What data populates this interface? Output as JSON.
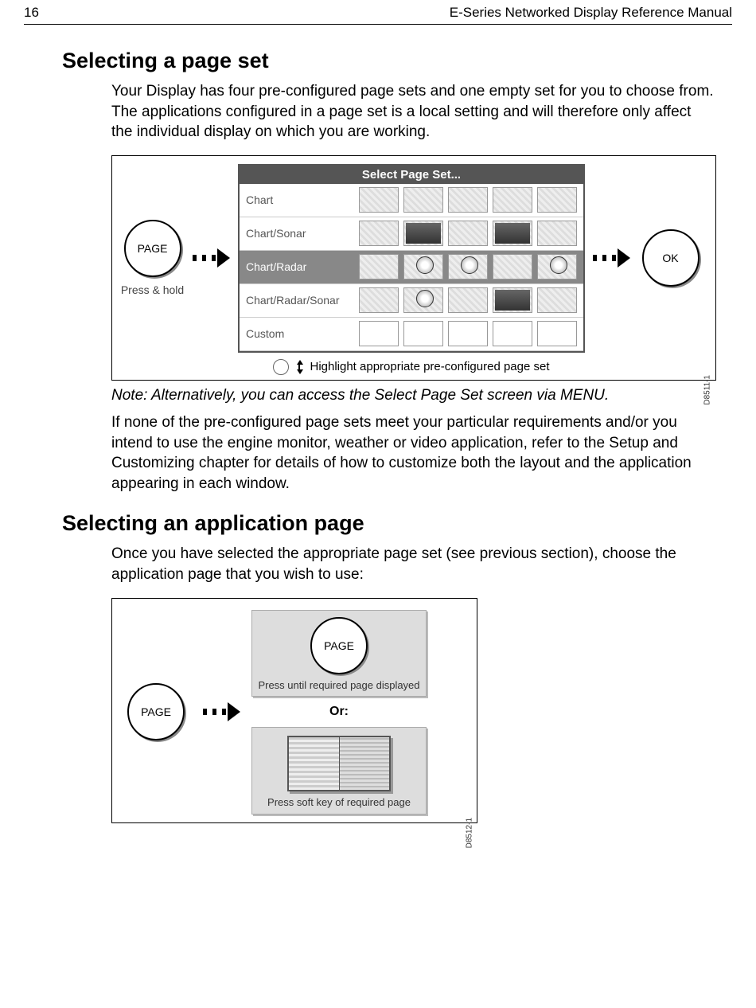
{
  "header": {
    "page_num": "16",
    "manual_title": "E-Series Networked Display Reference Manual"
  },
  "section1": {
    "heading": "Selecting a page set",
    "para1": "Your Display has four pre-configured page sets and one empty set for you to choose from. The applications configured in a page set is a local setting and will therefore only affect the individual display on which you are working.",
    "button_left": "PAGE",
    "button_left_caption": "Press & hold",
    "button_right": "OK",
    "dialog_title": "Select Page Set...",
    "rows": {
      "r0": "Chart",
      "r1": "Chart/Sonar",
      "r2": "Chart/Radar",
      "r3": "Chart/Radar/Sonar",
      "r4": "Custom"
    },
    "fig_caption": "Highlight appropriate pre-configured page set",
    "fig_id": "D8511-1",
    "note": "Note: Alternatively, you can access the Select Page Set screen via MENU.",
    "para2": "If none of the pre-configured page sets meet your particular requirements and/or you intend to use the engine monitor, weather or video application, refer to the Setup and Customizing chapter for details of how to customize both the layout and the application appearing in each window."
  },
  "section2": {
    "heading": "Selecting an application page",
    "para1": "Once you have selected the appropriate page set (see previous section), choose the application page that you wish to use:",
    "button_left": "PAGE",
    "panel_top_button": "PAGE",
    "panel_top_caption": "Press until required page displayed",
    "or_label": "Or:",
    "panel_bot_caption": "Press soft key of required page",
    "fig_id": "D8512-1"
  }
}
